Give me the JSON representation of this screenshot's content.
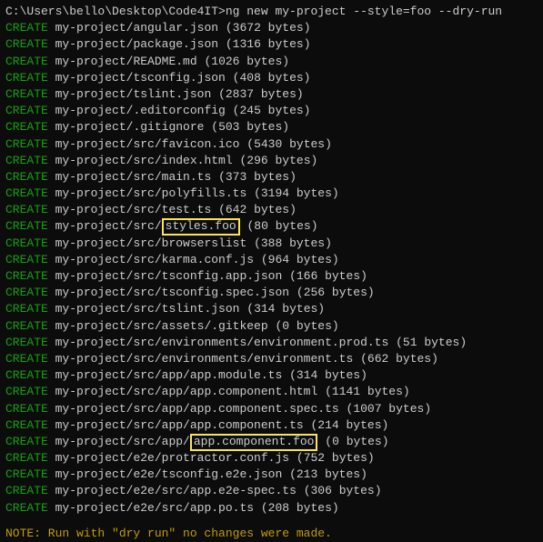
{
  "prompt": {
    "path": "C:\\Users\\bello\\Desktop\\Code4IT>",
    "command": "ng new my-project --style=foo --dry-run"
  },
  "action_label": "CREATE",
  "lines": [
    {
      "file": "my-project/angular.json",
      "size": "(3672 bytes)"
    },
    {
      "file": "my-project/package.json",
      "size": "(1316 bytes)"
    },
    {
      "file": "my-project/README.md",
      "size": "(1026 bytes)"
    },
    {
      "file": "my-project/tsconfig.json",
      "size": "(408 bytes)"
    },
    {
      "file": "my-project/tslint.json",
      "size": "(2837 bytes)"
    },
    {
      "file": "my-project/.editorconfig",
      "size": "(245 bytes)"
    },
    {
      "file": "my-project/.gitignore",
      "size": "(503 bytes)"
    },
    {
      "file": "my-project/src/favicon.ico",
      "size": "(5430 bytes)"
    },
    {
      "file": "my-project/src/index.html",
      "size": "(296 bytes)"
    },
    {
      "file": "my-project/src/main.ts",
      "size": "(373 bytes)"
    },
    {
      "file": "my-project/src/polyfills.ts",
      "size": "(3194 bytes)"
    },
    {
      "file": "my-project/src/test.ts",
      "size": "(642 bytes)"
    },
    {
      "file_pre": "my-project/src/",
      "file_hl": "styles.foo",
      "file_post": " ",
      "size": "(80 bytes)",
      "split": true
    },
    {
      "file": "my-project/src/browserslist",
      "size": "(388 bytes)"
    },
    {
      "file": "my-project/src/karma.conf.js",
      "size": "(964 bytes)"
    },
    {
      "file": "my-project/src/tsconfig.app.json",
      "size": "(166 bytes)"
    },
    {
      "file": "my-project/src/tsconfig.spec.json",
      "size": "(256 bytes)"
    },
    {
      "file": "my-project/src/tslint.json",
      "size": "(314 bytes)"
    },
    {
      "file": "my-project/src/assets/.gitkeep",
      "size": "(0 bytes)"
    },
    {
      "file": "my-project/src/environments/environment.prod.ts",
      "size": "(51 bytes)"
    },
    {
      "file": "my-project/src/environments/environment.ts",
      "size": "(662 bytes)"
    },
    {
      "file": "my-project/src/app/app.module.ts",
      "size": "(314 bytes)"
    },
    {
      "file": "my-project/src/app/app.component.html",
      "size": "(1141 bytes)"
    },
    {
      "file": "my-project/src/app/app.component.spec.ts",
      "size": "(1007 bytes)"
    },
    {
      "file": "my-project/src/app/app.component.ts",
      "size": "(214 bytes)"
    },
    {
      "file_pre": "my-project/src/app/",
      "file_hl": "app.component.foo",
      "file_post": " ",
      "size": "(0 bytes)",
      "split": true
    },
    {
      "file": "my-project/e2e/protractor.conf.js",
      "size": "(752 bytes)"
    },
    {
      "file": "my-project/e2e/tsconfig.e2e.json",
      "size": "(213 bytes)"
    },
    {
      "file": "my-project/e2e/src/app.e2e-spec.ts",
      "size": "(306 bytes)"
    },
    {
      "file": "my-project/e2e/src/app.po.ts",
      "size": "(208 bytes)"
    }
  ],
  "note": "NOTE: Run with \"dry run\" no changes were made."
}
